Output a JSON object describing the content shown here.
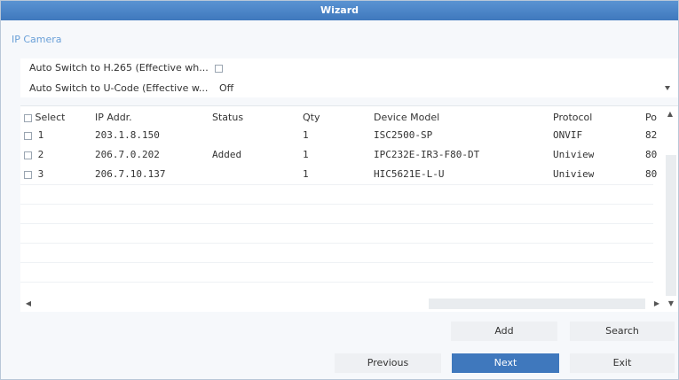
{
  "window": {
    "title": "Wizard"
  },
  "breadcrumb": "IP Camera",
  "options": {
    "h265_label": "Auto Switch to H.265 (Effective wh...",
    "h265_checked": false,
    "ucode_label": "Auto Switch to U-Code (Effective w...",
    "ucode_value": "Off"
  },
  "table": {
    "headers": {
      "select": "Select",
      "ip": "IP Addr.",
      "status": "Status",
      "qty": "Qty",
      "model": "Device Model",
      "protocol": "Protocol",
      "port": "Po"
    },
    "rows": [
      {
        "num": "1",
        "ip": "203.1.8.150",
        "status": "",
        "qty": "1",
        "model": "ISC2500-SP",
        "protocol": "ONVIF",
        "port": "82"
      },
      {
        "num": "2",
        "ip": "206.7.0.202",
        "status": "Added",
        "qty": "1",
        "model": "IPC232E-IR3-F80-DT",
        "protocol": "Uniview",
        "port": "80"
      },
      {
        "num": "3",
        "ip": "206.7.10.137",
        "status": "",
        "qty": "1",
        "model": "HIC5621E-L-U",
        "protocol": "Uniview",
        "port": "80"
      }
    ]
  },
  "buttons": {
    "add": "Add",
    "search": "Search",
    "previous": "Previous",
    "next": "Next",
    "exit": "Exit"
  },
  "scroll_glyphs": {
    "up": "▲",
    "down": "▼",
    "left": "◀",
    "right": "▶"
  },
  "colors": {
    "titlebar": "#4a86c8",
    "primary_button": "#3f78bd",
    "breadcrumb": "#6aa0d8"
  }
}
